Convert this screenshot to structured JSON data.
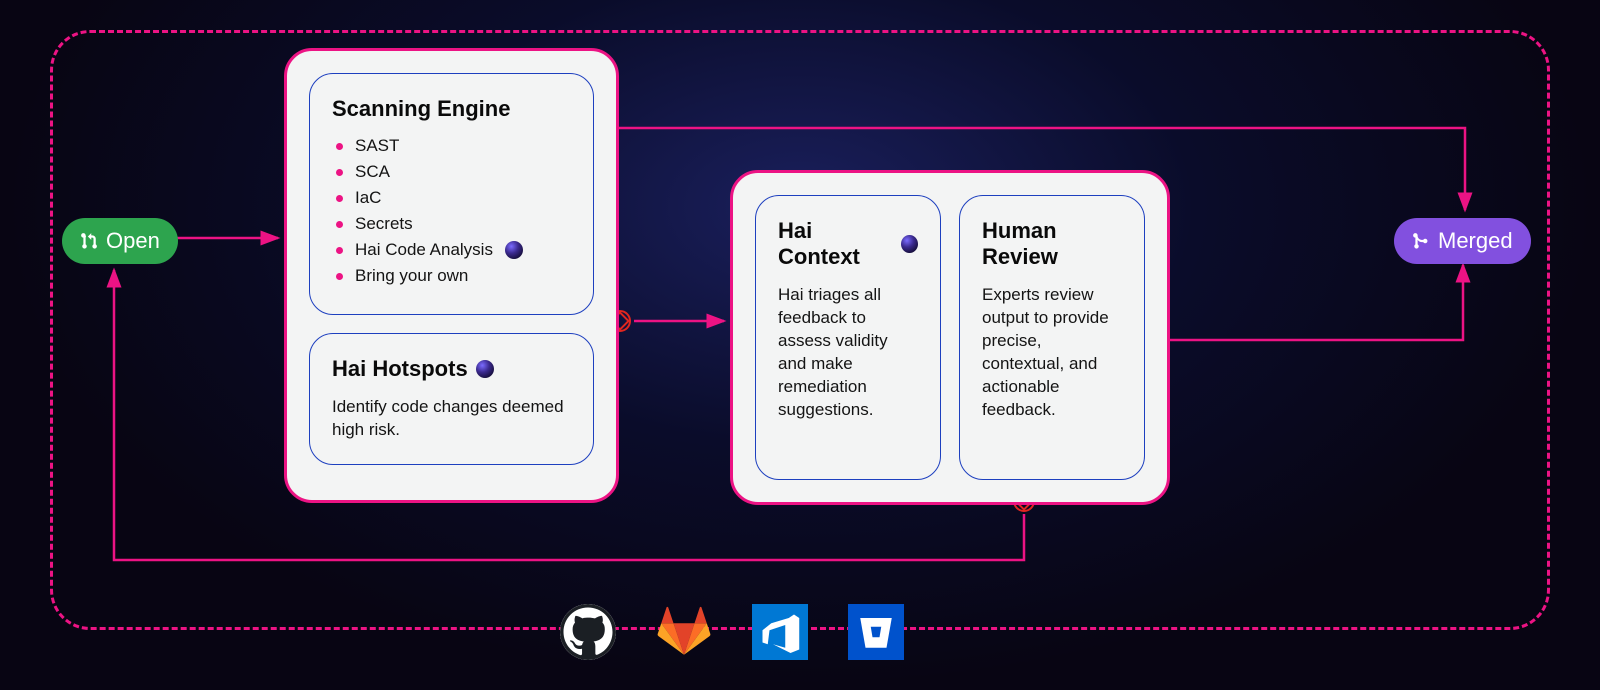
{
  "pills": {
    "open": "Open",
    "merged": "Merged"
  },
  "scanning": {
    "title": "Scanning Engine",
    "items": [
      "SAST",
      "SCA",
      "IaC",
      "Secrets",
      "Hai Code Analysis",
      "Bring your own"
    ]
  },
  "hotspots": {
    "title": "Hai Hotspots",
    "desc": "Identify code changes deemed high risk."
  },
  "context": {
    "title": "Hai Context",
    "desc": "Hai triages all feedback to assess validity and make remediation suggestions."
  },
  "review": {
    "title": "Human Review",
    "desc": "Experts review output to provide precise, contextual, and actionable feedback."
  },
  "integrations": [
    "github",
    "gitlab",
    "azure-devops",
    "bitbucket"
  ]
}
